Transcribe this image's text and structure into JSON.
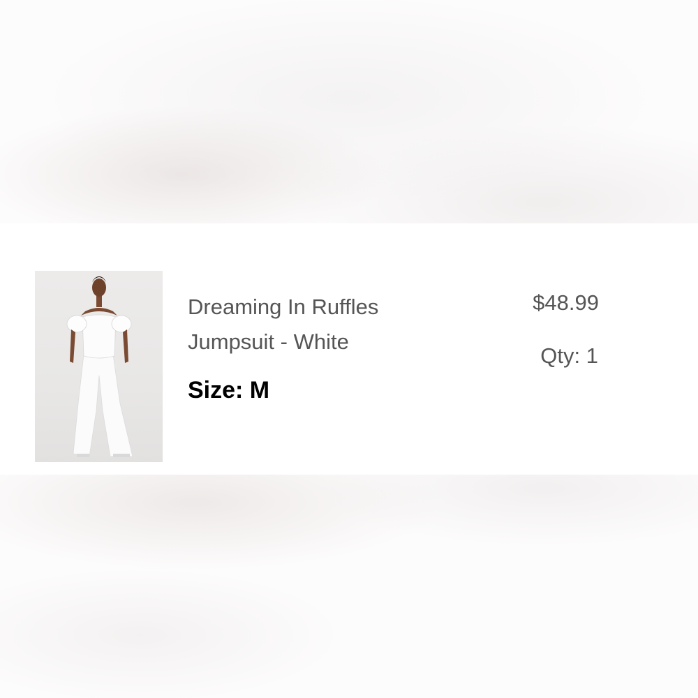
{
  "order_item": {
    "image_alt": "Model wearing white off-shoulder ruffle jumpsuit",
    "title_line1": "Dreaming In Ruffles",
    "title_line2": "Jumpsuit - White",
    "size_label": "Size: M",
    "price": "$48.99",
    "qty_label": "Qty: 1"
  }
}
